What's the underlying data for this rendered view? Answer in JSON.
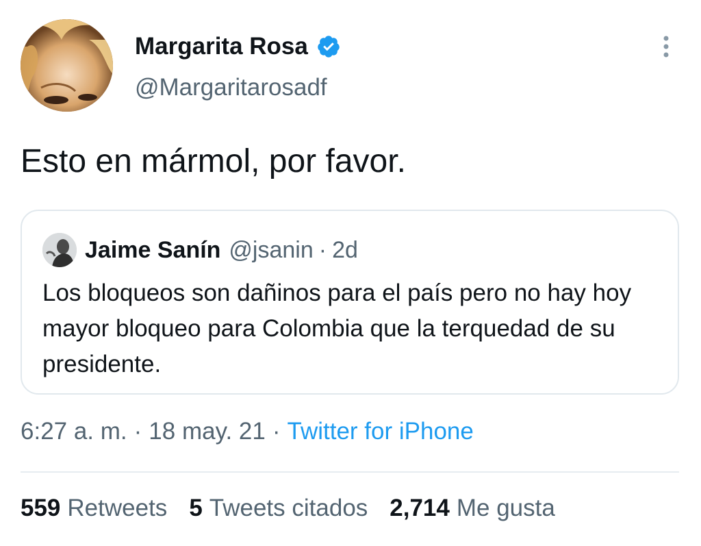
{
  "author": {
    "name": "Margarita Rosa",
    "handle": "@Margaritarosadf",
    "verified": true,
    "avatar_icon": "avatar-photo"
  },
  "tweet": {
    "text": "Esto en mármol, por favor."
  },
  "quoted_tweet": {
    "name": "Jaime Sanín",
    "handle": "@jsanin",
    "separator": "·",
    "time": "2d",
    "text": "Los bloqueos son dañinos para el país pero no hay hoy mayor bloqueo para Colombia que la terquedad de su presidente."
  },
  "meta": {
    "time": "6:27 a. m.",
    "separator": "·",
    "date": "18 may. 21",
    "source": "Twitter for iPhone"
  },
  "stats": {
    "retweets_count": "559",
    "retweets_label": "Retweets",
    "quotes_count": "5",
    "quotes_label": "Tweets citados",
    "likes_count": "2,714",
    "likes_label": "Me gusta"
  },
  "colors": {
    "accent": "#1d9bf0",
    "secondary_text": "#536471",
    "primary_text": "#0f1419"
  }
}
